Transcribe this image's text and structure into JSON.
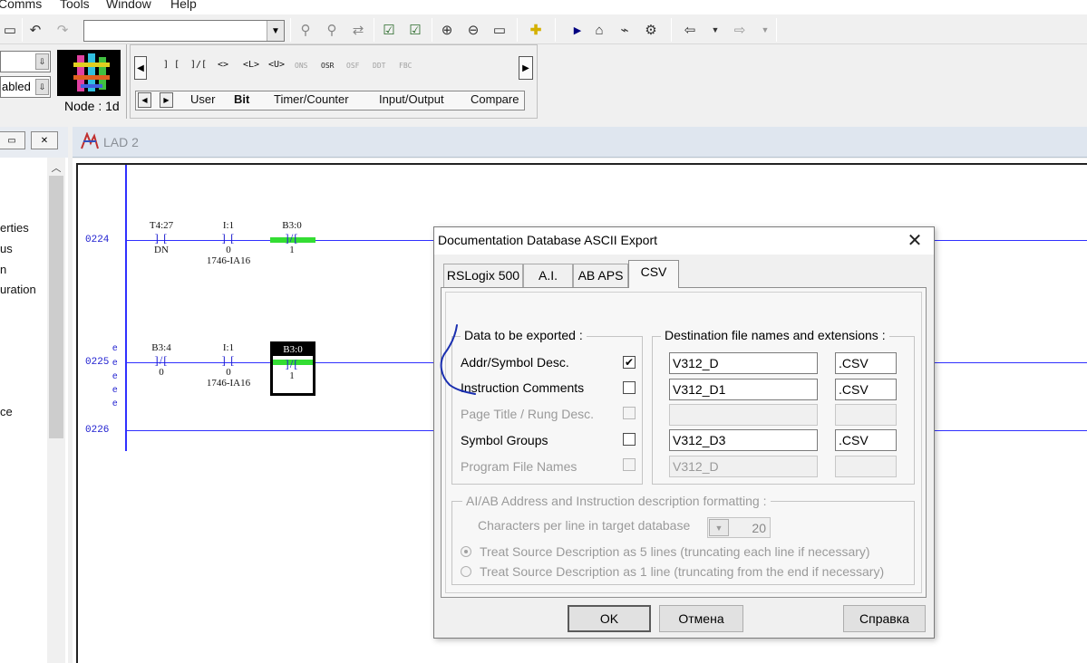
{
  "menu": {
    "items": [
      "Comms",
      "Tools",
      "Window",
      "Help"
    ]
  },
  "toolbar": {
    "combo_value": "",
    "combo_a_value": "",
    "combo_b_value": "abled",
    "node_label": "Node :  1d"
  },
  "instruction_palette": {
    "icons": [
      "] [",
      "]/[",
      "<>",
      "<L>",
      "<U>",
      "ONS",
      "OSR",
      "OSF",
      "DDT",
      "FBC"
    ],
    "tabs": [
      "User",
      "Bit",
      "Timer/Counter",
      "Input/Output",
      "Compare"
    ]
  },
  "project_tree": {
    "items": [
      "erties",
      "us",
      "n",
      "uration",
      "ce"
    ]
  },
  "ladder_window": {
    "title": "LAD 2",
    "rungs": [
      {
        "number": "0224",
        "contacts": [
          {
            "address": "T4:27",
            "symbol": "] [",
            "bit": "DN",
            "note": ""
          },
          {
            "address": "I:1",
            "symbol": "] [",
            "bit": "0",
            "note": "1746-IA16"
          },
          {
            "address": "B3:0",
            "symbol": "]/[",
            "bit": "1",
            "note": ""
          }
        ]
      },
      {
        "number": "0225",
        "contacts": [
          {
            "address": "B3:4",
            "symbol": "]/[",
            "bit": "0",
            "note": ""
          },
          {
            "address": "I:1",
            "symbol": "] [",
            "bit": "0",
            "note": "1746-IA16"
          },
          {
            "address": "B3:0",
            "symbol": "]/[",
            "bit": "1",
            "note": ""
          }
        ]
      },
      {
        "number": "0226",
        "contacts": []
      }
    ],
    "e_mark": "e"
  },
  "dialog": {
    "title": "Documentation Database ASCII Export",
    "tabs": [
      "RSLogix 500",
      "A.I.",
      "AB APS",
      "CSV"
    ],
    "active_tab": "CSV",
    "data_group_label": "Data to be exported  :",
    "dest_group_label": "Destination file names and extensions :",
    "rows": [
      {
        "label": "Addr/Symbol Desc.",
        "checked": true,
        "enabled": true,
        "filename": "V312_D",
        "ext": ".CSV"
      },
      {
        "label": "Instruction Comments",
        "checked": false,
        "enabled": true,
        "filename": "V312_D1",
        "ext": ".CSV"
      },
      {
        "label": "Page Title / Rung Desc.",
        "checked": false,
        "enabled": false,
        "filename": "",
        "ext": ""
      },
      {
        "label": "Symbol Groups",
        "checked": false,
        "enabled": true,
        "filename": "V312_D3",
        "ext": ".CSV"
      },
      {
        "label": "Program File Names",
        "checked": false,
        "enabled": false,
        "filename": "V312_D",
        "ext": ""
      }
    ],
    "format_group_label": "AI/AB Address and Instruction description formatting :",
    "chars_per_line_label": "Characters per line in target database",
    "chars_per_line_value": "20",
    "radio_options": [
      {
        "label": "Treat Source Description as 5 lines (truncating each line if necessary)",
        "selected": true
      },
      {
        "label": "Treat Source Description as 1 line (truncating from the end if necessary)",
        "selected": false
      }
    ],
    "buttons": {
      "ok": "OK",
      "cancel": "Отмена",
      "help": "Справка"
    },
    "close_glyph": "✕"
  },
  "colors": {
    "rung_blue": "#3030ff",
    "energized_green": "#33dd33",
    "annotation_stroke": "#1a2fb0"
  }
}
